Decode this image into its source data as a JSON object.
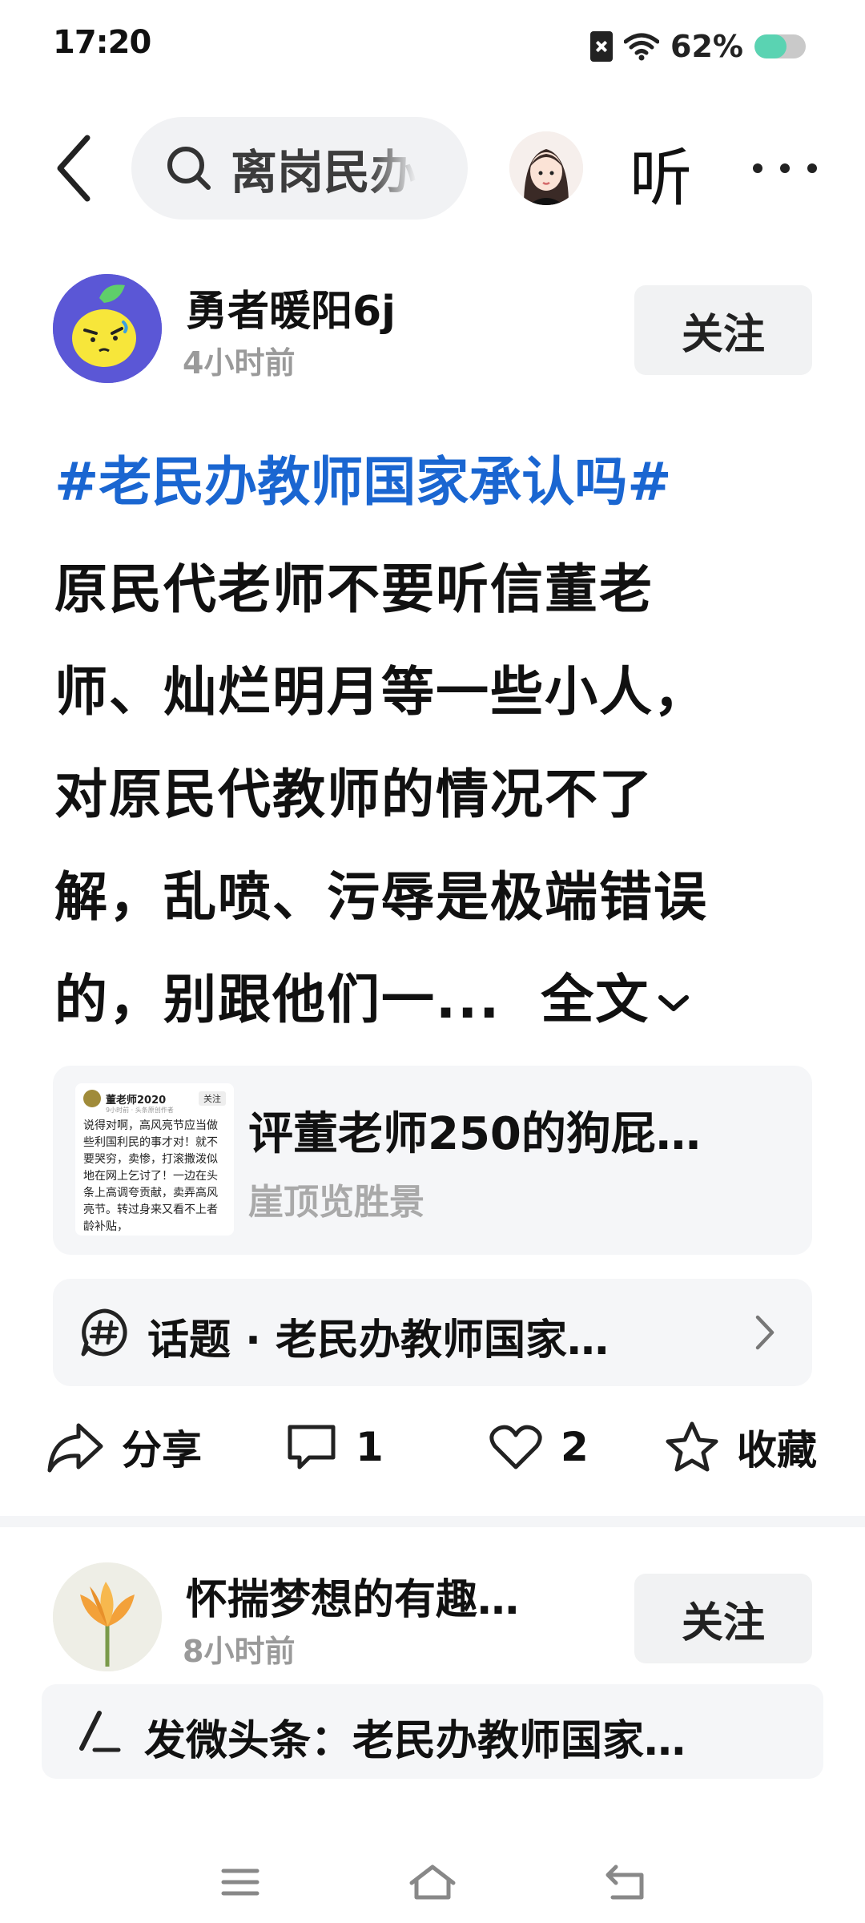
{
  "status_bar": {
    "time": "17:20",
    "battery_percent_label": "62%",
    "battery_level": 0.62,
    "battery_color": "#5ad3b2"
  },
  "nav": {
    "back_icon": "chevron-left-icon",
    "search_text": "离岗民办",
    "listen_label": "听",
    "more_icon": "ellipsis-icon"
  },
  "post1": {
    "author_name": "勇者暖阳6j",
    "time": "4小时前",
    "follow_label": "关注",
    "topic_tag": "#老民办教师国家承认吗#",
    "body_lines": [
      "原民代老师不要听信董老",
      "师、灿烂明月等一些小人，",
      "对原民代教师的情况不了",
      "解，乱喷、污辱是极端错误",
      "的，别跟他们一..."
    ],
    "full_text_label": "全文",
    "quote": {
      "thumb_name": "董老师2020",
      "thumb_follow": "关注",
      "thumb_sub": "9小时前 · 头条原创作者",
      "thumb_text": "说得对啊，高风亮节应当做些利国利民的事才对！就不要哭穷，卖惨，打滚撒泼似地在网上乞讨了！一边在头条上高调夸贡献，卖弄高风亮节。转过身来又看不上者龄补贴，",
      "title": "评董老师250的狗屁…",
      "source": "崖顶览胜景"
    },
    "topic_row": {
      "icon": "hashtag-chat-icon",
      "label": "话题 · 老民办教师国家…"
    },
    "actions": {
      "share_label": "分享",
      "comment_count": "1",
      "like_count": "2",
      "favorite_label": "收藏"
    },
    "accent_color": "#1a66d1"
  },
  "post2": {
    "author_name": "怀揣梦想的有趣…",
    "time": "8小时前",
    "follow_label": "关注",
    "weitoutiao_label": "发微头条：老民办教师国家…"
  },
  "system_nav": {
    "menu_icon": "menu-icon",
    "home_icon": "home-icon",
    "back_icon": "back-icon"
  }
}
